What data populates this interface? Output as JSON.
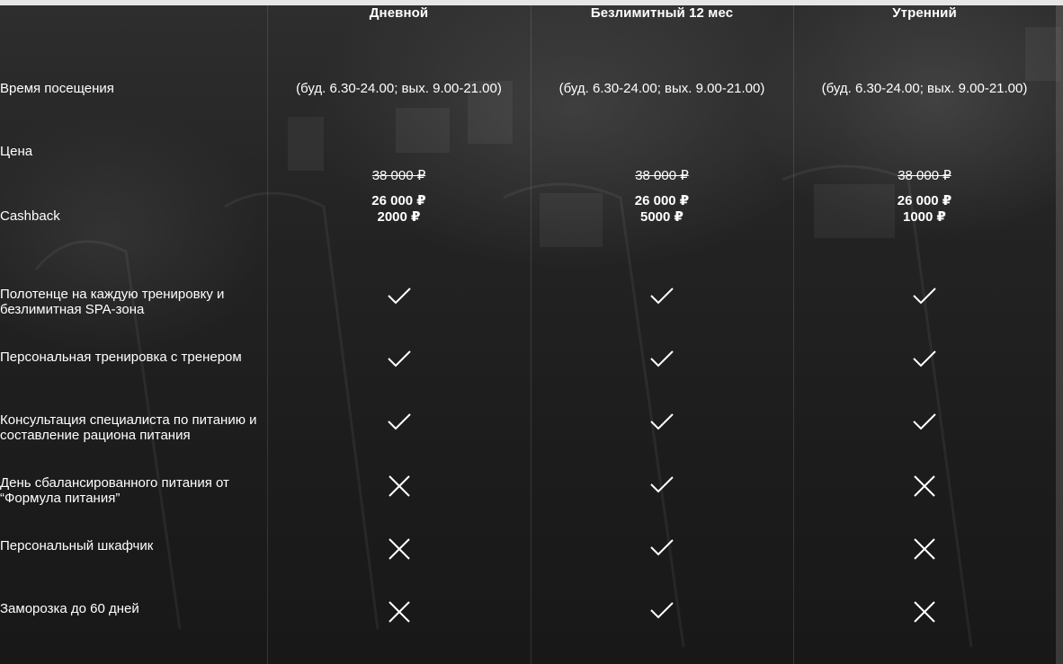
{
  "plans": [
    {
      "name": "Дневной"
    },
    {
      "name": "Безлимитный 12 мес"
    },
    {
      "name": "Утренний"
    }
  ],
  "rows": {
    "time": {
      "label": "Время посещения",
      "values": [
        "(буд. 6.30-24.00; вых. 9.00-21.00)",
        "(буд. 6.30-24.00; вых. 9.00-21.00)",
        "(буд. 6.30-24.00; вых. 9.00-21.00)"
      ]
    },
    "price": {
      "label": "Цена",
      "old": [
        "38 000 ₽",
        "38 000 ₽",
        "38 000 ₽"
      ],
      "new": [
        "26 000 ₽",
        "26 000 ₽",
        "26 000 ₽"
      ]
    },
    "cashback": {
      "label": "Cashback",
      "values": [
        "2000 ₽",
        "5000 ₽",
        "1000 ₽"
      ]
    },
    "features": [
      {
        "label": "Полотенце на каждую тренировку и безлимитная SPA-зона",
        "included": [
          true,
          true,
          true
        ]
      },
      {
        "label": "Персональная тренировка с тренером",
        "included": [
          true,
          true,
          true
        ]
      },
      {
        "label": "Консультация специалиста по питанию и составление рациона питания",
        "included": [
          true,
          true,
          true
        ]
      },
      {
        "label": "День сбалансированного питания от “Формула питания”",
        "included": [
          false,
          true,
          false
        ]
      },
      {
        "label": "Персональный шкафчик",
        "included": [
          false,
          true,
          false
        ]
      },
      {
        "label": "Заморозка до 60 дней",
        "included": [
          false,
          true,
          false
        ]
      }
    ]
  },
  "icons": {
    "included": "check-icon",
    "excluded": "cross-icon"
  },
  "colors": {
    "background": "#1c1c1c",
    "text": "#ffffff",
    "divider": "rgba(255,255,255,0.12)"
  }
}
